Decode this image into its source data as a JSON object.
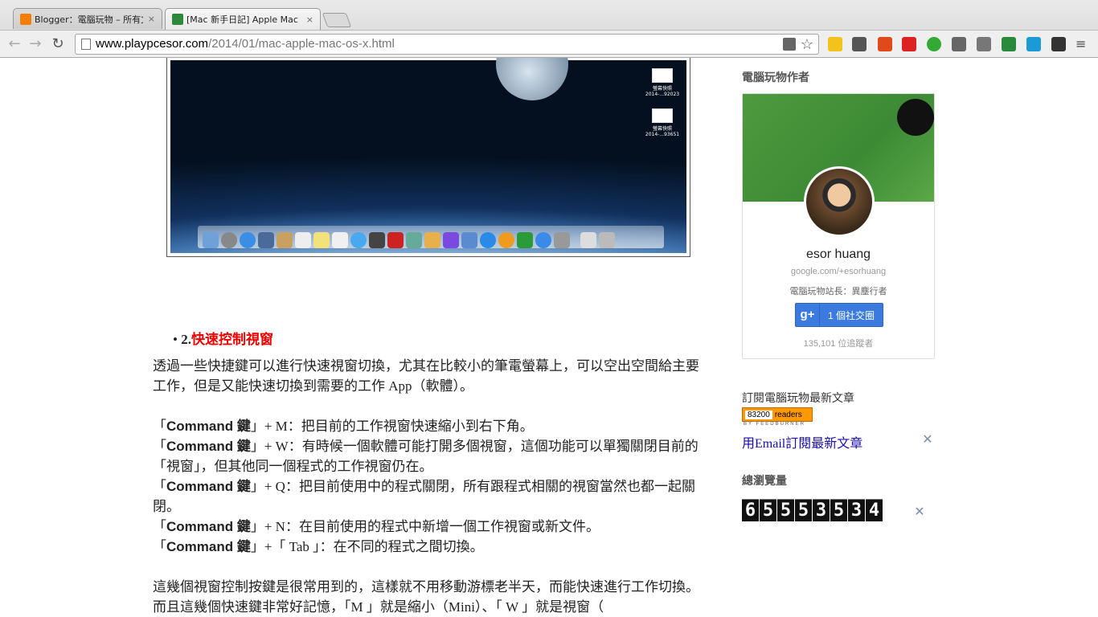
{
  "browser": {
    "tabs": [
      {
        "title": "Blogger：電腦玩物 – 所有文",
        "close": "×",
        "favicon_color": "#f57d00"
      },
      {
        "title": "[Mac 新手日記] Apple Mac ©",
        "close": "×",
        "favicon_color": "#2d8a3c"
      }
    ],
    "url_domain": "www.playpcesor.com",
    "url_path": "/2014/01/mac-apple-mac-os-x.html"
  },
  "article": {
    "heading_num": "2.",
    "heading_text": "快速控制視窗",
    "intro": "透過一些快捷鍵可以進行快速視窗切換，尤其在比較小的筆電螢幕上，可以空出空間給主要工作，但是又能快速切換到需要的工作 App（軟體）。",
    "shortcuts": [
      {
        "pre": "「",
        "key": "Command 鍵",
        "post": "」+ M：把目前的工作視窗快速縮小到右下角。"
      },
      {
        "pre": "「",
        "key": "Command 鍵",
        "post": "」+ W：有時候一個軟體可能打開多個視窗，這個功能可以單獨關閉目前的「視窗」，但其他同一個程式的工作視窗仍在。"
      },
      {
        "pre": "「",
        "key": "Command 鍵",
        "post": "」+ Q：把目前使用中的程式關閉，所有跟程式相關的視窗當然也都一起關閉。"
      },
      {
        "pre": "「",
        "key": "Command 鍵",
        "post": "」+ N：在目前使用的程式中新增一個工作視窗或新文件。"
      },
      {
        "pre": "「",
        "key": "Command 鍵",
        "post": "」+「 Tab 」：在不同的程式之間切換。"
      }
    ],
    "outro": "這幾個視窗控制按鍵是很常用到的，這樣就不用移動游標老半天，而能快速進行工作切換。而且這幾個快速鍵非常好記憶，「M 」就是縮小（Mini）、「 W 」就是視窗（"
  },
  "screenshot": {
    "desktop_icons": [
      {
        "label": "螢幕快照 2014-...92023"
      },
      {
        "label": "螢幕快照 2014-...93651"
      }
    ]
  },
  "sidebar": {
    "author_title": "電腦玩物作者",
    "profile": {
      "name": "esor huang",
      "url": "google.com/+esorhuang",
      "desc": "電腦玩物站長：異塵行者",
      "button_icon": "g+",
      "button_label": "1 個社交圈",
      "followers": "135,101 位追蹤者"
    },
    "subscribe_title": "訂閱電腦玩物最新文章",
    "feed_count": "83200",
    "feed_label": "readers",
    "feed_by": "BY FEEDBURNER",
    "email_link": "用Email訂閱最新文章",
    "views_title": "總瀏覽量",
    "views_digits": [
      "6",
      "5",
      "5",
      "5",
      "3",
      "5",
      "3",
      "4"
    ]
  }
}
